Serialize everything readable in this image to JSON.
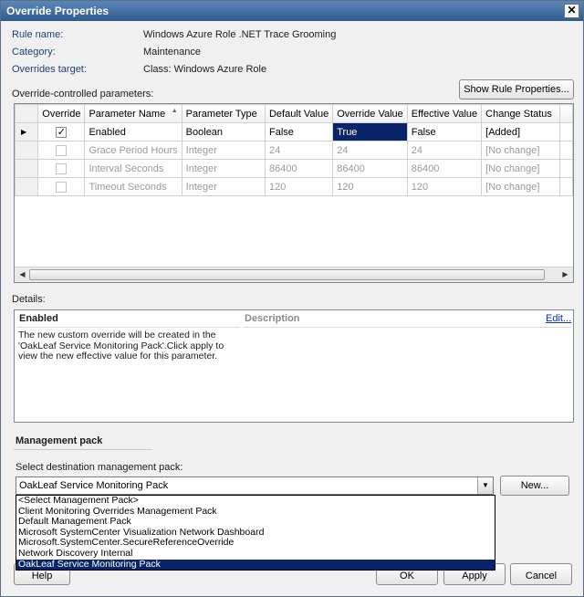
{
  "window": {
    "title": "Override Properties",
    "close_glyph": "✕"
  },
  "rule": {
    "name_label": "Rule name:",
    "name_value": "Windows Azure Role .NET Trace Grooming",
    "category_label": "Category:",
    "category_value": "Maintenance",
    "target_label": "Overrides target:",
    "target_value": "Class: Windows Azure Role"
  },
  "params": {
    "section_label": "Override-controlled parameters:",
    "show_rule_button": "Show Rule Properties...",
    "columns": [
      "Override",
      "Parameter Name",
      "Parameter Type",
      "Default Value",
      "Override Value",
      "Effective Value",
      "Change Status"
    ],
    "sort_glyph": "▲",
    "rows": [
      {
        "checked": true,
        "name": "Enabled",
        "type": "Boolean",
        "default": "False",
        "override": "True",
        "effective": "False",
        "status": "[Added]"
      },
      {
        "checked": false,
        "name": "Grace Period Hours",
        "type": "Integer",
        "default": "24",
        "override": "24",
        "effective": "24",
        "status": "[No change]"
      },
      {
        "checked": false,
        "name": "Interval Seconds",
        "type": "Integer",
        "default": "86400",
        "override": "86400",
        "effective": "86400",
        "status": "[No change]"
      },
      {
        "checked": false,
        "name": "Timeout Seconds",
        "type": "Integer",
        "default": "120",
        "override": "120",
        "effective": "120",
        "status": "[No change]"
      }
    ]
  },
  "details": {
    "label": "Details:",
    "heading": "Enabled",
    "description_header": "Description",
    "edit_link": "Edit...",
    "text": "The new custom override will be created in the 'OakLeaf Service Monitoring Pack'.Click apply to view  the new effective value for this parameter."
  },
  "management_pack": {
    "section_title": "Management pack",
    "select_label": "Select destination management pack:",
    "selected_value": "OakLeaf Service Monitoring Pack",
    "new_button": "New...",
    "options": [
      "<Select Management Pack>",
      "Client Monitoring Overrides Management Pack",
      "Default Management Pack",
      "Microsoft SystemCenter Visualization Network Dashboard",
      "Microsoft.SystemCenter.SecureReferenceOverride",
      "Network Discovery Internal",
      "OakLeaf Service Monitoring Pack"
    ],
    "selected_index": 6
  },
  "footer": {
    "help": "Help",
    "ok": "OK",
    "apply": "Apply",
    "cancel": "Cancel"
  },
  "colors": {
    "selection": "#0a246a",
    "title_bar": "#2e5b8e",
    "link": "#0033cc"
  }
}
